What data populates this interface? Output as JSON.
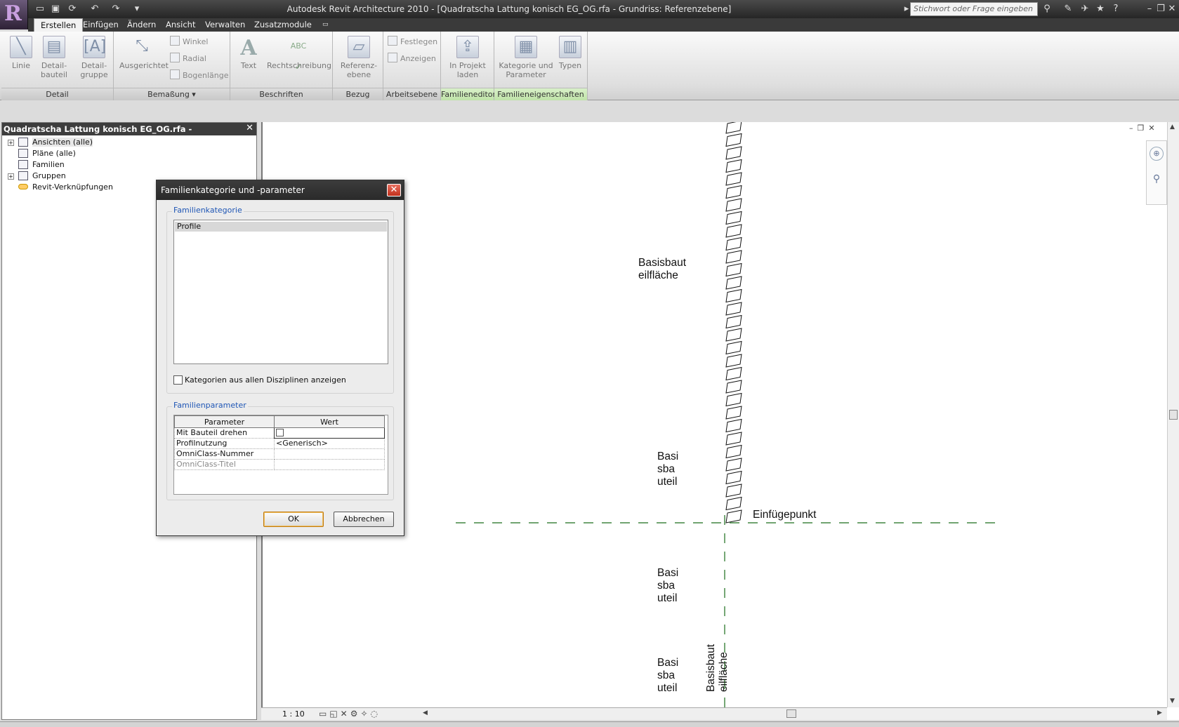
{
  "titlebar": {
    "title": "Autodesk Revit Architecture 2010 - [Quadratscha Lattung konisch EG_OG.rfa - Grundriss: Referenzebene]",
    "search_placeholder": "Stichwort oder Frage eingeben"
  },
  "menu": {
    "tabs": [
      "Erstellen",
      "Einfügen",
      "Ändern",
      "Ansicht",
      "Verwalten",
      "Zusatzmodule"
    ]
  },
  "ribbon": {
    "detail": {
      "label": "Detail",
      "linie": "Linie",
      "detailbauteil": "Detail-\nbauteil",
      "detailgruppe": "Detail-\ngruppe"
    },
    "bemassung": {
      "label": "Bemaßung",
      "ausgerichtet": "Ausgerichtet",
      "winkel": "Winkel",
      "radial": "Radial",
      "bogenlaenge": "Bogenlänge"
    },
    "beschriften": {
      "label": "Beschriften",
      "text": "Text",
      "rechtschreibung": "Rechtschreibung"
    },
    "bezug": {
      "label": "Bezug",
      "referenzebene": "Referenz-\nebene"
    },
    "arbeitsebene": {
      "label": "Arbeitsebene",
      "festlegen": "Festlegen",
      "anzeigen": "Anzeigen"
    },
    "familieneditor": {
      "label": "Familieneditor",
      "inprojekt": "In Projekt\nladen"
    },
    "familieneigenschaften": {
      "label": "Familieneigenschaften",
      "kategorie": "Kategorie und\nParameter",
      "typen": "Typen"
    }
  },
  "browser": {
    "title": "Quadratscha Lattung konisch EG_OG.rfa - Projektbrowser",
    "items": [
      "Ansichten (alle)",
      "Pläne (alle)",
      "Familien",
      "Gruppen",
      "Revit-Verknüpfungen"
    ]
  },
  "canvas": {
    "label_top_1": "Basisbaut",
    "label_top_2": "eilfläche",
    "basis_1": "Basi",
    "basis_2": "sba",
    "basis_3": "uteil",
    "einfuegepunkt": "Einfügepunkt",
    "rot_1": "Basisbaut",
    "rot_2": "eilfläche",
    "scale": "1 : 10"
  },
  "dialog": {
    "title": "Familienkategorie und -parameter",
    "category_group": "Familienkategorie",
    "categories": [
      "Profile"
    ],
    "all_disciplines": "Kategorien aus allen Disziplinen anzeigen",
    "params_group": "Familienparameter",
    "col_parameter": "Parameter",
    "col_wert": "Wert",
    "rows": [
      {
        "name": "Mit Bauteil drehen",
        "value": ""
      },
      {
        "name": "Profilnutzung",
        "value": "<Generisch>"
      },
      {
        "name": "OmniClass-Nummer",
        "value": ""
      },
      {
        "name": "OmniClass-Titel",
        "value": ""
      }
    ],
    "ok": "OK",
    "cancel": "Abbrechen"
  }
}
